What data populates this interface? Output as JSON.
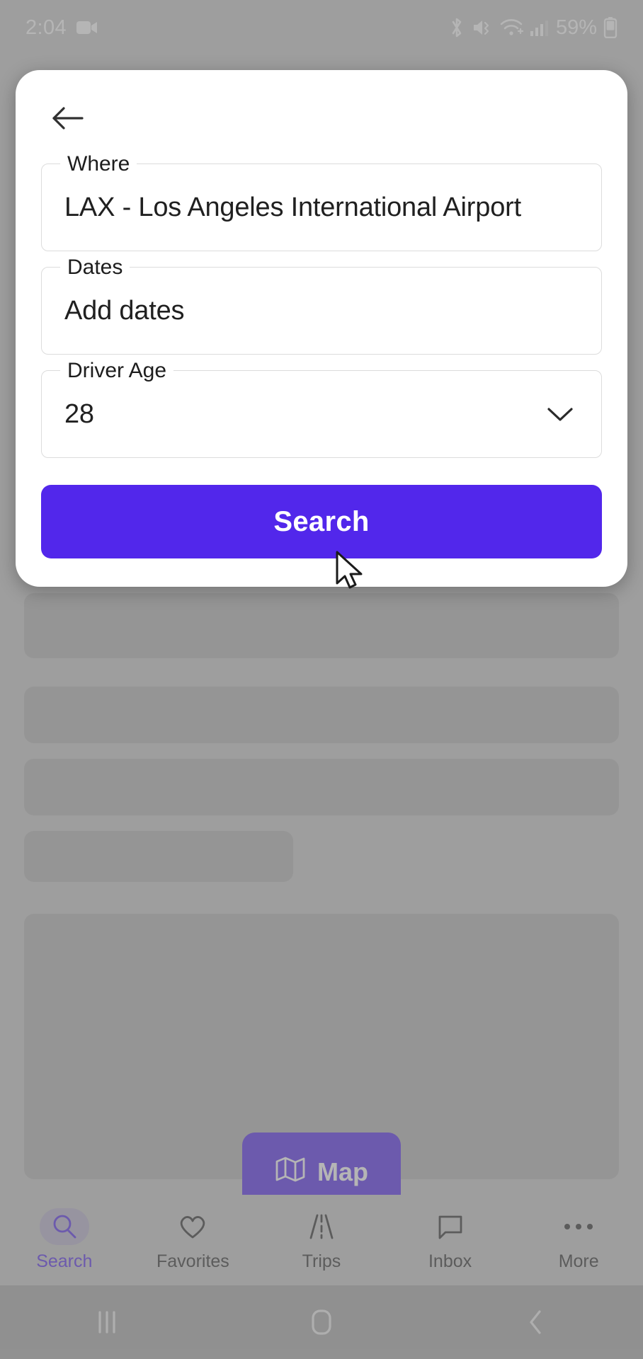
{
  "status_bar": {
    "time": "2:04",
    "recording_icon": "video-camera-icon",
    "bluetooth_icon": "bluetooth-icon",
    "mute_icon": "mute-vibrate-icon",
    "wifi_icon": "wifi-icon",
    "signal_icon": "cellular-signal-icon",
    "battery_percent": "59%",
    "battery_icon": "battery-icon"
  },
  "dialog": {
    "back_label": "Back",
    "back_icon": "arrow-left-icon",
    "fields": [
      {
        "label": "Where",
        "value": "LAX - Los Angeles International Airport"
      },
      {
        "label": "Dates",
        "value": "Add dates"
      },
      {
        "label": "Driver Age",
        "value": "28",
        "icon": "chevron-down-icon"
      }
    ],
    "search_button": "Search"
  },
  "map_fab": {
    "label": "Map",
    "icon": "map-folded-icon",
    "color": "#5227eb"
  },
  "bottom_nav": {
    "active_color": "#5227eb",
    "items": [
      {
        "label": "Search",
        "icon": "magnifier-icon"
      },
      {
        "label": "Favorites",
        "icon": "heart-icon"
      },
      {
        "label": "Trips",
        "icon": "road-icon"
      },
      {
        "label": "Inbox",
        "icon": "chat-bubble-icon"
      },
      {
        "label": "More",
        "icon": "ellipsis-icon"
      }
    ]
  },
  "system_nav": {
    "recents_icon": "recents-bars-icon",
    "home_icon": "home-square-icon",
    "back_icon": "chevron-left-icon"
  },
  "cursor": {
    "icon": "mouse-pointer-icon"
  }
}
